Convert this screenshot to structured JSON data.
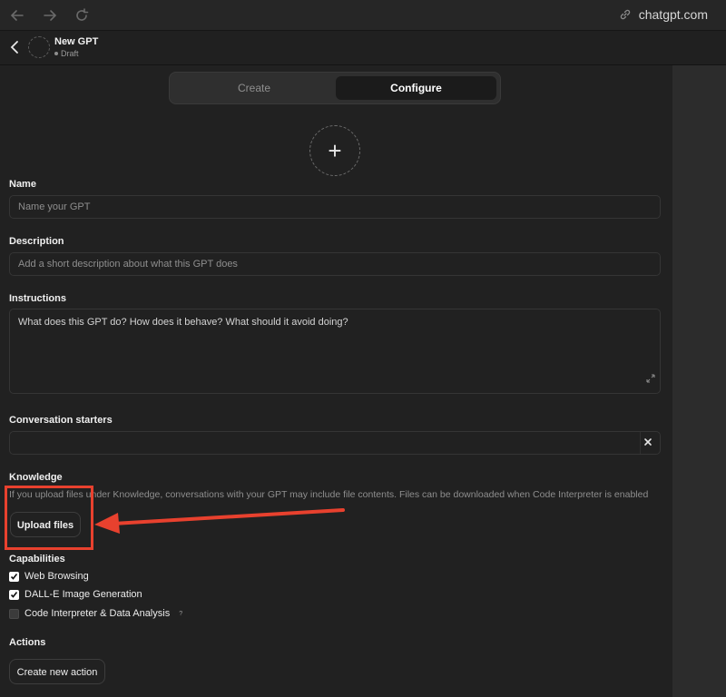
{
  "browser": {
    "url": "chatgpt.com",
    "icons": {
      "back": "arrow-left-icon",
      "forward": "arrow-right-icon",
      "reload": "reload-icon",
      "link": "link-icon"
    }
  },
  "gpt": {
    "title": "New GPT",
    "status": "Draft"
  },
  "tabs": {
    "create": "Create",
    "configure": "Configure"
  },
  "form": {
    "name_label": "Name",
    "name_placeholder": "Name your GPT",
    "description_label": "Description",
    "description_placeholder": "Add a short description about what this GPT does",
    "instructions_label": "Instructions",
    "instructions_placeholder": "What does this GPT do? How does it behave? What should it avoid doing?",
    "starters_label": "Conversation starters",
    "starter_value": "",
    "knowledge_label": "Knowledge",
    "knowledge_help": "If you upload files under Knowledge, conversations with your GPT may include file contents. Files can be downloaded when Code Interpreter is enabled",
    "upload_button": "Upload files",
    "capabilities_label": "Capabilities",
    "capabilities": [
      {
        "label": "Web Browsing",
        "checked": true
      },
      {
        "label": "DALL-E Image Generation",
        "checked": true
      },
      {
        "label": "Code Interpreter & Data Analysis",
        "checked": false,
        "info": "?"
      }
    ],
    "actions_label": "Actions",
    "create_action_button": "Create new action"
  },
  "colors": {
    "accent_annotation": "#e8412e",
    "background": "#212121"
  }
}
